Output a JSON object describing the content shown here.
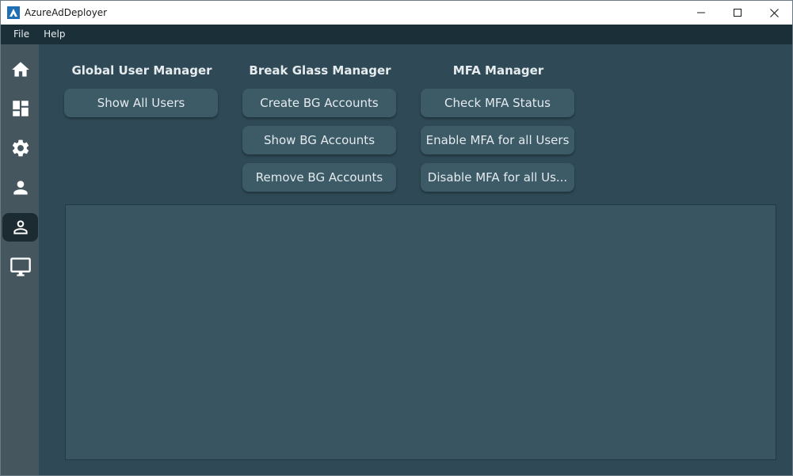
{
  "window": {
    "title": "AzureAdDeployer"
  },
  "menu": [
    "File",
    "Help"
  ],
  "sidebar": {
    "items": [
      {
        "icon": "home-icon",
        "active": false
      },
      {
        "icon": "dashboard-icon",
        "active": false
      },
      {
        "icon": "gear-icon",
        "active": false
      },
      {
        "icon": "user-icon",
        "active": false
      },
      {
        "icon": "user-outline-icon",
        "active": true
      },
      {
        "icon": "monitor-icon",
        "active": false
      }
    ]
  },
  "sections": {
    "global": {
      "title": "Global User Manager",
      "buttons": [
        "Show All Users"
      ]
    },
    "breakglass": {
      "title": "Break Glass Manager",
      "buttons": [
        "Create BG Accounts",
        "Show BG Accounts",
        "Remove BG Accounts"
      ]
    },
    "mfa": {
      "title": "MFA Manager",
      "buttons": [
        "Check MFA Status",
        "Enable MFA for all Users",
        "Disable MFA for all Us..."
      ]
    }
  },
  "output": {
    "text": ""
  }
}
